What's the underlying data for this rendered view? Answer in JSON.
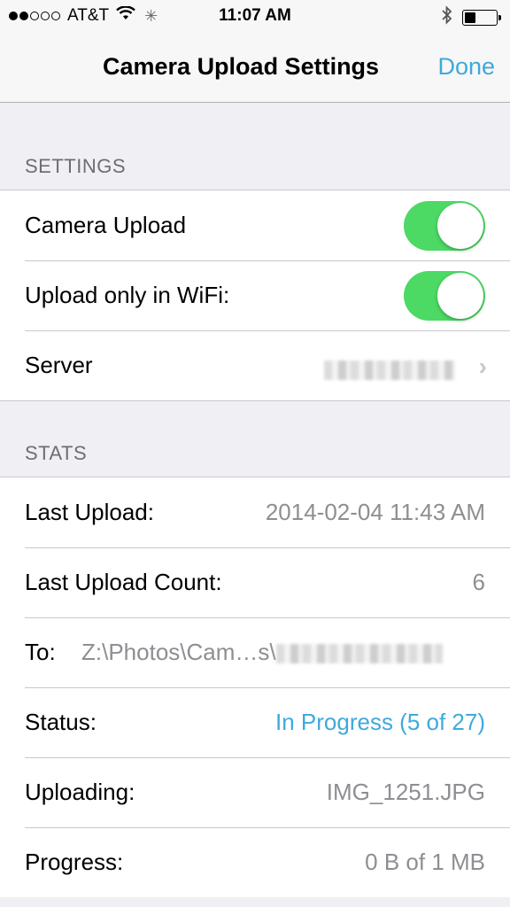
{
  "status_bar": {
    "carrier": "AT&T",
    "time": "11:07 AM",
    "signal_bars_filled": 2,
    "signal_bars_total": 5,
    "battery_level": 0.35
  },
  "nav": {
    "title": "Camera Upload Settings",
    "done_label": "Done"
  },
  "settings": {
    "header": "SETTINGS",
    "camera_upload_label": "Camera Upload",
    "camera_upload_on": true,
    "wifi_only_label": "Upload only in WiFi:",
    "wifi_only_on": true,
    "server_label": "Server"
  },
  "stats": {
    "header": "STATS",
    "last_upload_label": "Last Upload:",
    "last_upload_value": "2014-02-04 11:43 AM",
    "last_count_label": "Last Upload Count:",
    "last_count_value": "6",
    "to_label": "To:",
    "to_value": "Z:\\Photos\\Cam…s\\",
    "status_label": "Status:",
    "status_value": "In Progress (5 of 27)",
    "uploading_label": "Uploading:",
    "uploading_value": "IMG_1251.JPG",
    "progress_label": "Progress:",
    "progress_value": "0 B of 1 MB"
  },
  "colors": {
    "accent": "#3fa9dc",
    "toggle_on": "#4cd964",
    "background": "#efeff4"
  }
}
